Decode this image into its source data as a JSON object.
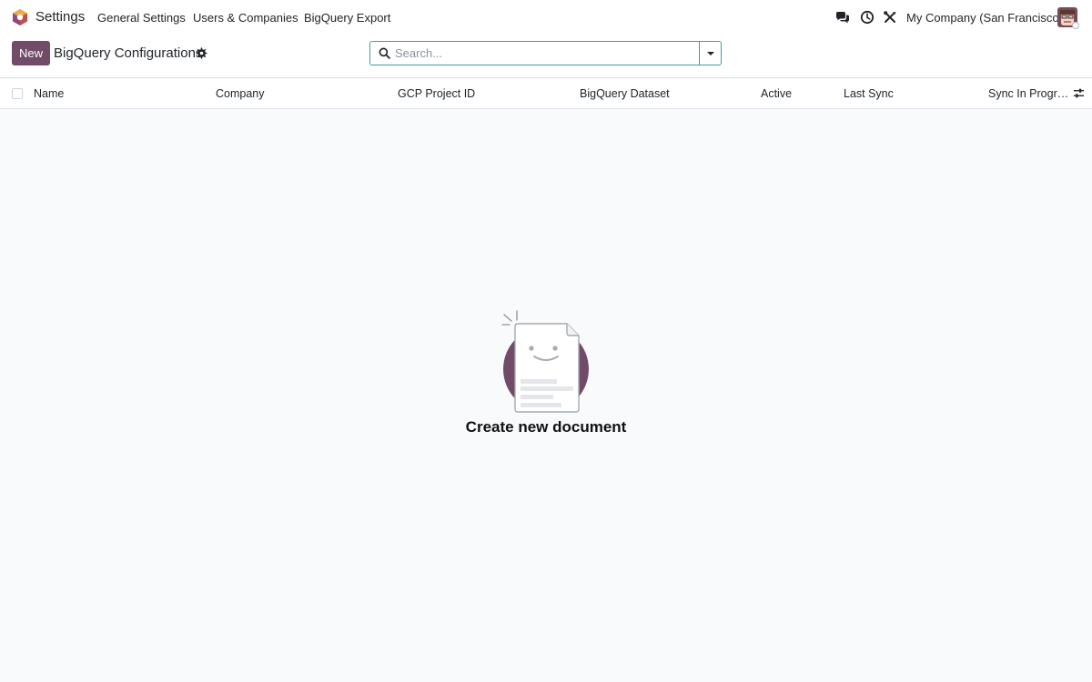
{
  "navbar": {
    "app_name": "Settings",
    "menu": [
      "General Settings",
      "Users & Companies",
      "BigQuery Export"
    ],
    "systray_icons": [
      "chat-icon",
      "clock-icon",
      "tools-icon"
    ],
    "company": "My Company (San Francisco)"
  },
  "control_panel": {
    "new_label": "New",
    "title": "BigQuery Configurations",
    "search_placeholder": "Search..."
  },
  "list": {
    "columns": [
      "Name",
      "Company",
      "GCP Project ID",
      "BigQuery Dataset",
      "Active",
      "Last Sync",
      "Sync In Progr…"
    ]
  },
  "empty_state": {
    "title": "Create new document"
  },
  "colors": {
    "brand": "#714b67",
    "search_border": "#3d9ba7"
  }
}
